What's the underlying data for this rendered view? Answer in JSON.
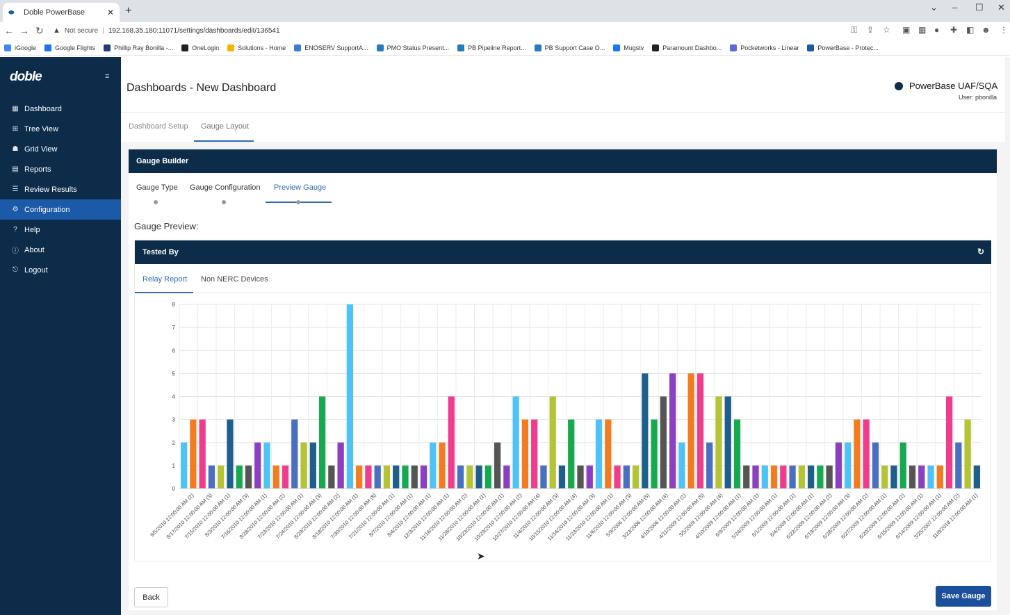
{
  "browser": {
    "tab_title": "Doble PowerBase",
    "url": "192.168.35.180:11071/settings/dashboards/edit/136541",
    "security_label": "Not secure",
    "bookmarks": [
      {
        "label": "iGoogle",
        "color": "#4285f4"
      },
      {
        "label": "Google Flights",
        "color": "#1a73e8"
      },
      {
        "label": "Phillip Ray Bonilla -...",
        "color": "#1c3f7c"
      },
      {
        "label": "OneLogin",
        "color": "#222222"
      },
      {
        "label": "Solutions - Home",
        "color": "#f4b400"
      },
      {
        "label": "ENOSERV SupportA...",
        "color": "#3a7bd5"
      },
      {
        "label": "PMO Status Present...",
        "color": "#2a7ab8"
      },
      {
        "label": "PB Pipeline Report...",
        "color": "#2a7ab8"
      },
      {
        "label": "PB Support Case O...",
        "color": "#2a7ab8"
      },
      {
        "label": "Mugstv",
        "color": "#1877f2"
      },
      {
        "label": "Paramount Dashbo...",
        "color": "#222222"
      },
      {
        "label": "Pocketworks - Linear",
        "color": "#5e6ad2"
      },
      {
        "label": "PowerBase - Protec...",
        "color": "#1b5aa8"
      }
    ]
  },
  "sidebar": {
    "logo": "doble",
    "items": [
      {
        "label": "Dashboard",
        "icon": "grid-icon",
        "glyph": "▦"
      },
      {
        "label": "Tree View",
        "icon": "tree-icon",
        "glyph": "⊞"
      },
      {
        "label": "Grid View",
        "icon": "sitemap-icon",
        "glyph": "☗"
      },
      {
        "label": "Reports",
        "icon": "report-icon",
        "glyph": "▤"
      },
      {
        "label": "Review Results",
        "icon": "list-icon",
        "glyph": "☰"
      },
      {
        "label": "Configuration",
        "icon": "gear-icon",
        "glyph": "⚙"
      },
      {
        "label": "Help",
        "icon": "help-icon",
        "glyph": "?"
      },
      {
        "label": "About",
        "icon": "info-icon",
        "glyph": "ⓘ"
      },
      {
        "label": "Logout",
        "icon": "logout-icon",
        "glyph": "⎋"
      }
    ],
    "active_index": 5
  },
  "header": {
    "title": "Dashboards - New Dashboard",
    "system_name": "PowerBase UAF/SQA",
    "user": "User: pbonilla"
  },
  "top_tabs": [
    "Dashboard Setup",
    "Gauge Layout"
  ],
  "builder": {
    "title": "Gauge Builder",
    "steps": [
      "Gauge Type",
      "Gauge Configuration",
      "Preview Gauge"
    ],
    "preview_label": "Gauge Preview:"
  },
  "gauge": {
    "title": "Tested By",
    "tabs": [
      "Relay Report",
      "Non NERC Devices"
    ]
  },
  "buttons": {
    "back": "Back",
    "save": "Save Gauge"
  },
  "chart_data": {
    "type": "bar",
    "ylim": [
      0,
      8
    ],
    "yticks": [
      0,
      1,
      2,
      3,
      4,
      5,
      6,
      7,
      8
    ],
    "grid": true,
    "palette": [
      "#4fc3f7",
      "#f47c20",
      "#f03c8c",
      "#4a6fc0",
      "#b5c435",
      "#1f5f8b",
      "#16a94f",
      "#555555",
      "#8c3fc0"
    ],
    "values": [
      2,
      3,
      3,
      1,
      1,
      3,
      1,
      1,
      2,
      2,
      1,
      1,
      3,
      2,
      2,
      4,
      1,
      2,
      8,
      1,
      1,
      1,
      1,
      1,
      1,
      1,
      1,
      2,
      2,
      4,
      1,
      1,
      1,
      1,
      2,
      1,
      4,
      3,
      3,
      1,
      4,
      1,
      3,
      1,
      1,
      3,
      3,
      1,
      1,
      1,
      5,
      3,
      4,
      5,
      2,
      5,
      5,
      2,
      4,
      4,
      3,
      1,
      1,
      1,
      1,
      1,
      1,
      1,
      1,
      1,
      1,
      2,
      2,
      3,
      3,
      2,
      1,
      1,
      2,
      1,
      1,
      1,
      1,
      4,
      2,
      3,
      1
    ],
    "x_labels": [
      "9/5/2010 12:00:00 AM (2)",
      "8/17/2010 12:00:00 AM (3)",
      "7/15/2010 12:00:00 AM (1)",
      "8/3/2010 12:00:00 AM (3)",
      "7/16/2010 12:00:00 AM (1)",
      "8/28/2010 12:00:00 AM (2)",
      "7/23/2010 12:00:00 AM (1)",
      "7/24/2010 12:00:00 AM (3)",
      "8/29/2010 12:00:00 AM (2)",
      "8/18/2010 12:00:00 AM (1)",
      "7/30/2010 12:00:00 AM (8)",
      "7/21/2010 12:00:00 AM (1)",
      "8/7/2010 12:00:00 AM (1)",
      "8/4/2010 12:00:00 AM (1)",
      "12/3/2010 12:00:00 AM (1)",
      "11/16/2010 12:00:00 AM (2)",
      "11/28/2010 12:00:00 AM (1)",
      "10/23/2010 12:00:00 AM (1)",
      "10/29/2010 12:00:00 AM (2)",
      "10/27/2010 12:00:00 AM (4)",
      "11/4/2010 12:00:00 AM (3)",
      "10/15/2010 12:00:00 AM (4)",
      "11/14/2010 12:00:00 AM (3)",
      "11/23/2010 12:00:00 AM (1)",
      "11/6/2010 12:00:00 AM (3)",
      "5/9/2006 12:00:00 AM (5)",
      "3/23/2006 12:00:00 AM (4)",
      "4/10/2006 12:00:00 AM (2)",
      "4/11/2009 12:00:00 AM (5)",
      "3/5/2009 12:00:00 AM (4)",
      "4/10/2009 12:00:00 AM (1)",
      "6/9/2009 12:00:00 AM (1)",
      "5/24/2009 12:00:00 AM (1)",
      "6/1/2009 12:00:00 AM (1)",
      "6/4/2009 12:00:00 AM (1)",
      "6/22/2009 12:00:00 AM (2)",
      "6/19/2009 12:00:00 AM (3)",
      "6/28/2009 12:00:00 AM (2)",
      "6/27/2009 12:00:00 AM (1)",
      "6/20/2009 12:00:00 AM (2)",
      "6/15/2009 12:00:00 AM (1)",
      "6/14/2009 12:00:00 AM (1)",
      "3/25/2007 12:00:00 AM (2)",
      "11/8/2018 12:00:00 AM (1)"
    ]
  }
}
